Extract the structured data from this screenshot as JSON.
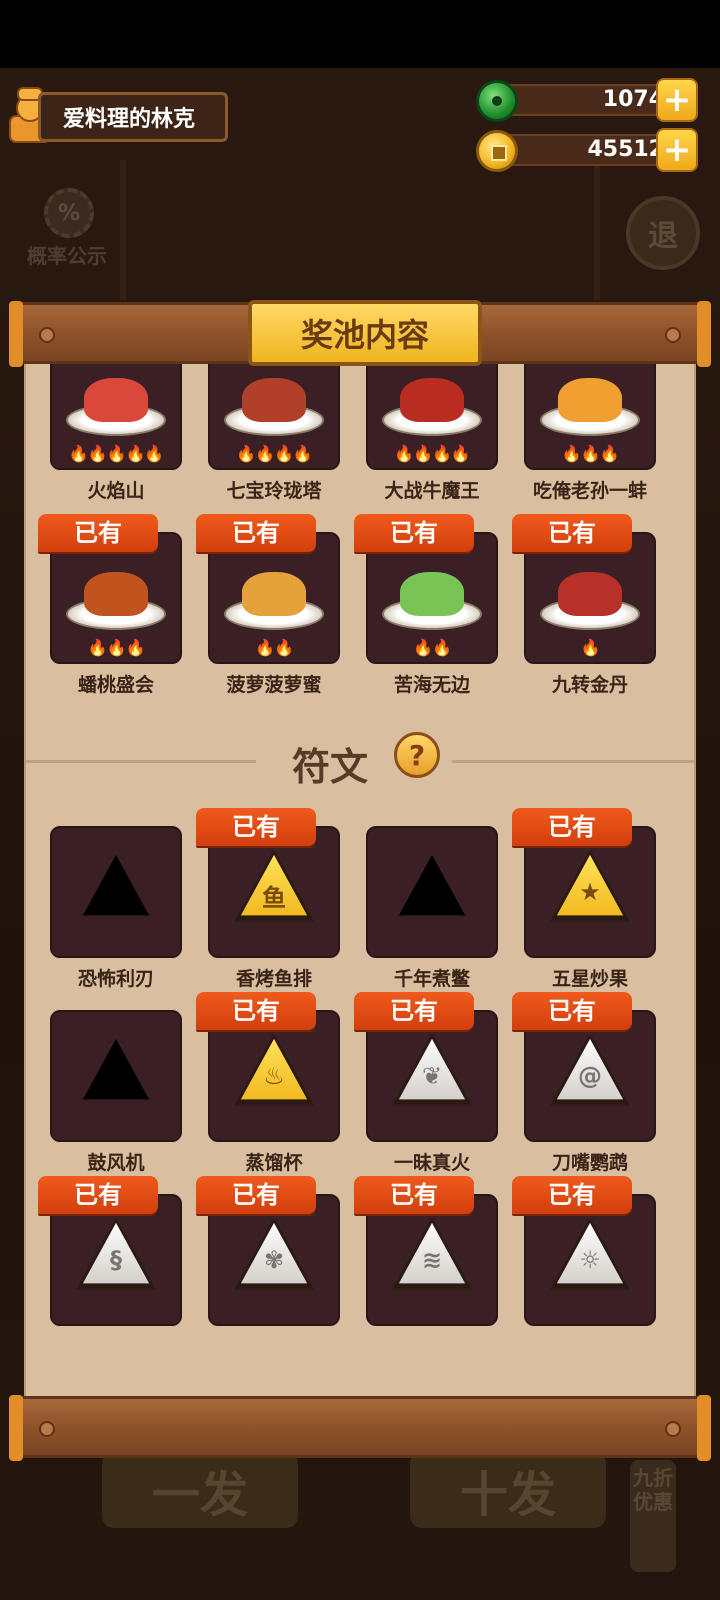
{
  "player": {
    "name": "爱料理的林克"
  },
  "currency": {
    "jade": "1074",
    "gold": "45512",
    "add_label": "+"
  },
  "background": {
    "probability_label": "概率公示",
    "probability_icon": "%",
    "exit_label": "退",
    "draw_one": "一发",
    "draw_ten": "十发",
    "discount": "九折优惠"
  },
  "panel": {
    "title": "奖池内容",
    "owned_label": "已有"
  },
  "dishes": [
    {
      "name": "火焰山",
      "flames": 5,
      "owned": false,
      "color": "#d9483a"
    },
    {
      "name": "七宝玲珑塔",
      "flames": 4,
      "owned": false,
      "color": "#b0402a"
    },
    {
      "name": "大战牛魔王",
      "flames": 4,
      "owned": false,
      "color": "#b82c22"
    },
    {
      "name": "吃俺老孙一蚌",
      "flames": 3,
      "owned": false,
      "color": "#f0a030"
    },
    {
      "name": "蟠桃盛会",
      "flames": 3,
      "owned": true,
      "color": "#c0531e"
    },
    {
      "name": "菠萝菠萝蜜",
      "flames": 2,
      "owned": true,
      "color": "#e6a23a"
    },
    {
      "name": "苦海无边",
      "flames": 2,
      "owned": true,
      "color": "#7ac455"
    },
    {
      "name": "九转金丹",
      "flames": 1,
      "owned": true,
      "color": "#b8302a"
    }
  ],
  "runes_section": {
    "title": "符文",
    "help_icon": "?"
  },
  "runes": [
    {
      "name": "恐怖利刃",
      "owned": false,
      "style": "locked",
      "glyph": ""
    },
    {
      "name": "香烤鱼排",
      "owned": true,
      "style": "gold",
      "glyph": "鱼"
    },
    {
      "name": "千年煮鳖",
      "owned": false,
      "style": "locked",
      "glyph": ""
    },
    {
      "name": "五星炒果",
      "owned": true,
      "style": "gold",
      "glyph": "★"
    },
    {
      "name": "鼓风机",
      "owned": false,
      "style": "locked",
      "glyph": ""
    },
    {
      "name": "蒸馏杯",
      "owned": true,
      "style": "gold",
      "glyph": "♨"
    },
    {
      "name": "一昧真火",
      "owned": true,
      "style": "silver",
      "glyph": "❦"
    },
    {
      "name": "刀嘴鹦鹉",
      "owned": true,
      "style": "silver",
      "glyph": "@"
    },
    {
      "name": "",
      "owned": true,
      "style": "silver",
      "glyph": "§"
    },
    {
      "name": "",
      "owned": true,
      "style": "silver",
      "glyph": "✾"
    },
    {
      "name": "",
      "owned": true,
      "style": "silver",
      "glyph": "≋"
    },
    {
      "name": "",
      "owned": true,
      "style": "silver",
      "glyph": "☼"
    }
  ],
  "colors": {
    "owned_badge": "#e24a14",
    "card_bg": "#3a2024",
    "paper": "#d9bfa0",
    "title_plate": "#f5c236"
  }
}
